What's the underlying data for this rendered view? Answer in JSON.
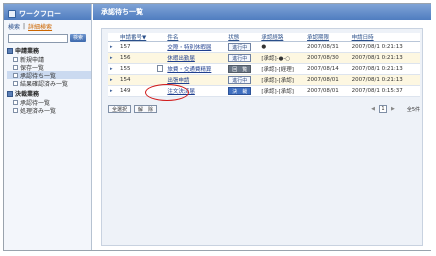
{
  "sidebar": {
    "title": "ワークフロー",
    "search_label": "検索",
    "search_sep": "|",
    "advanced_search": "詳細検索",
    "search_button": "検索",
    "search_placeholder": "",
    "groups": [
      {
        "label": "申請業務",
        "items": [
          {
            "label": "新規申請"
          },
          {
            "label": "保存一覧"
          },
          {
            "label": "承認待ち一覧",
            "selected": true
          },
          {
            "label": "結果確認済み一覧"
          }
        ]
      },
      {
        "label": "決裁業務",
        "items": [
          {
            "label": "承認待一覧"
          },
          {
            "label": "処理済み一覧"
          }
        ]
      }
    ]
  },
  "main": {
    "title": "承認待ち一覧",
    "columns": [
      "申請番号▼",
      "件名",
      "状態",
      "承認経路",
      "承認期限",
      "申請日時"
    ],
    "rows": [
      {
        "num": "157",
        "subject": "交際・特別休暇届",
        "status": "進行中",
        "route": "●",
        "deadline": "2007/08/31",
        "date": "2007/08/1 0:21:13",
        "badge": "normal"
      },
      {
        "num": "156",
        "subject": "休暇出勤届",
        "status": "進行中",
        "route": "[承認]-●-○",
        "deadline": "2007/08/30",
        "date": "2007/08/1 0:21:13",
        "badge": "normal"
      },
      {
        "num": "155",
        "subject": "旅費・交通費精算",
        "status": "回　覧",
        "route": "[承認]-[経理]",
        "deadline": "2007/08/14",
        "date": "2007/08/1 0:21:13",
        "badge": "dark",
        "doc_icon": true
      },
      {
        "num": "154",
        "subject": "出張申請",
        "status": "進行中",
        "route": "[承認]-[承認]",
        "deadline": "2007/08/01",
        "date": "2007/08/1 0:21:13",
        "badge": "normal"
      },
      {
        "num": "149",
        "subject": "注文決済届",
        "status": "決　裁",
        "route": "[承認]-[承認]",
        "deadline": "2007/08/01",
        "date": "2007/08/1 0:15:37",
        "badge": "blue"
      }
    ],
    "footer": {
      "select_all": "全選択",
      "clear": "解　除",
      "prev": "◀",
      "page": "1",
      "next": "▶",
      "count": "全5件"
    }
  }
}
